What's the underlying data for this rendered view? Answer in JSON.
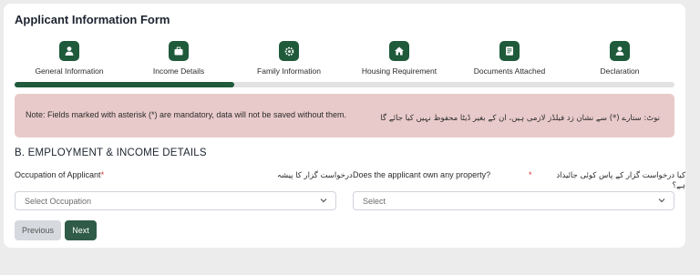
{
  "form": {
    "title": "Applicant Information Form",
    "progress_fraction": 0.333
  },
  "steps": [
    {
      "label": "General Information",
      "icon": "person-icon"
    },
    {
      "label": "Income Details",
      "icon": "briefcase-icon"
    },
    {
      "label": "Family Information",
      "icon": "gear-icon"
    },
    {
      "label": "Housing Requirement",
      "icon": "home-icon"
    },
    {
      "label": "Documents Attached",
      "icon": "document-icon"
    },
    {
      "label": "Declaration",
      "icon": "person-icon"
    }
  ],
  "note": {
    "en": "Note: Fields marked with asterisk (*) are mandatory, data will not be saved without them.",
    "ur": "نوٹ: ستارے (*) سے نشان زد فیلڈز لازمی ہیں، ان کے بغیر ڈیٹا محفوظ نہیں کیا جائے گا"
  },
  "section": {
    "title": "B. EMPLOYMENT & INCOME DETAILS"
  },
  "fields": {
    "occupation": {
      "label": "Occupation of Applicant",
      "required": "*",
      "urdu": "درخواست گزار کا پیشہ",
      "placeholder": "Select Occupation"
    },
    "property": {
      "label": "Does the applicant own any property?",
      "required": "*",
      "urdu": "کیا درخواست گزار کے پاس کوئی جائیداد ہے؟",
      "placeholder": "Select"
    }
  },
  "buttons": {
    "previous": "Previous",
    "next": "Next"
  },
  "colors": {
    "accent": "#1f5a3b",
    "note_bg": "#e9caca",
    "next_button": "#2f5b48"
  }
}
